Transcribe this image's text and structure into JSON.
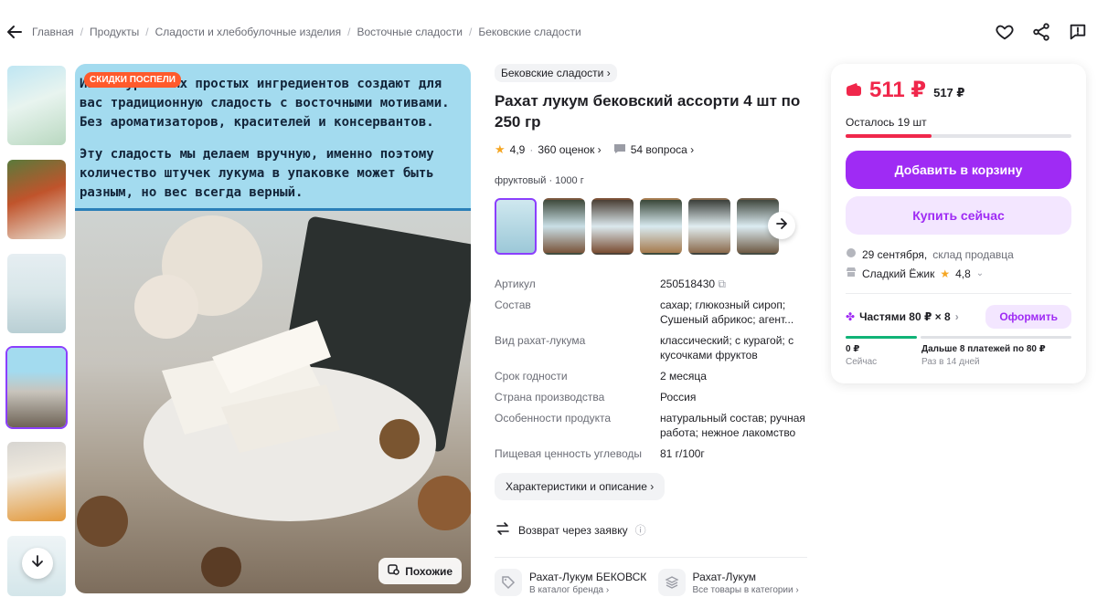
{
  "breadcrumbs": [
    "Главная",
    "Продукты",
    "Сладости и хлебобулочные изделия",
    "Восточные сладости",
    "Бековские сладости"
  ],
  "header_icons": [
    "heart-icon",
    "share-icon",
    "report-icon"
  ],
  "gallery": {
    "badge": "СКИДКИ ПОСПЕЛИ",
    "promo_text_1": "Из натуральных простых ингредиентов создают для вас традиционную сладость с восточными мотивами. Без ароматизаторов, красителей и консервантов.",
    "promo_text_2": "Эту сладость мы делаем вручную, именно поэтому количество штучек лукума в упаковке может быть разным, но вес всегда верный.",
    "similar_button": "Похожие"
  },
  "product": {
    "category_chip": "Бековские сладости",
    "title": "Рахат лукум бековский ассорти 4 шт по 250 гр",
    "rating": "4,9",
    "reviews": "360 оценок",
    "questions": "54 вопроса",
    "variant_label": "фруктовый · 1000 г",
    "specs": [
      {
        "k": "Артикул",
        "v": "250518430"
      },
      {
        "k": "Состав",
        "v": "сахар; глюкозный сироп; Сушеный абрикос; агент..."
      },
      {
        "k": "Вид рахат-лукума",
        "v": "классический; с курагой; с кусочками фруктов"
      },
      {
        "k": "Срок годности",
        "v": "2 месяца"
      },
      {
        "k": "Страна производства",
        "v": "Россия"
      },
      {
        "k": "Особенности продукта",
        "v": "натуральный состав; ручная работа; нежное лакомство"
      },
      {
        "k": "Пищевая ценность углеводы",
        "v": "81 г/100г"
      }
    ],
    "chars_button": "Характеристики и описание",
    "return_text": "Возврат через заявку",
    "brand_link": {
      "title": "Рахат-Лукум БЕКОВСК",
      "sub": "В каталог бренда"
    },
    "category_link": {
      "title": "Рахат-Лукум",
      "sub": "Все товары в категории"
    }
  },
  "buy": {
    "price": "511 ₽",
    "old_price": "517 ₽",
    "stock_text": "Осталось 19 шт",
    "stock_fraction": 0.38,
    "cart_button": "Добавить в корзину",
    "buy_now_button": "Купить сейчас",
    "delivery_date": "29 сентября,",
    "delivery_from": "склад продавца",
    "seller_name": "Сладкий Ёжик",
    "seller_rating": "4,8",
    "installments": "Частями 80 ₽ × 8",
    "order_button": "Оформить",
    "now_amount": "0 ₽",
    "now_label": "Сейчас",
    "later_amount": "Дальше 8 платежей по 80 ₽",
    "later_label": "Раз в 14 дней"
  },
  "colors": {
    "accent": "#9f2bf4",
    "price": "#f0274b",
    "promo_bg": "#a3dbef"
  }
}
